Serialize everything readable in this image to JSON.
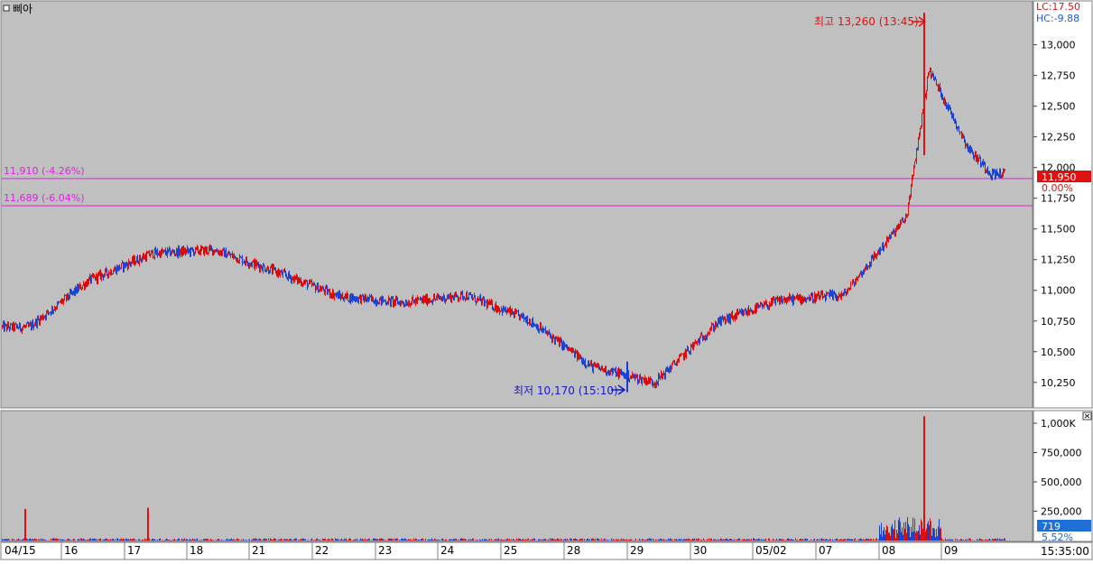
{
  "title": "삐아",
  "colors": {
    "plot_bg": "#c0c0c0",
    "up": "#e01010",
    "down": "#1840d0",
    "ref_line": "#e020e0",
    "max_label": "#e01010",
    "min_label": "#1818c8",
    "current_badge_bg": "#e01010",
    "volume_badge_bg": "#1f6fd6"
  },
  "header": {
    "lc": "LC:17.50",
    "hc": "HC:-9.88"
  },
  "price_panel": {
    "yticks": [
      "13,000",
      "12,750",
      "12,500",
      "12,250",
      "12,000",
      "11,750",
      "11,500",
      "11,250",
      "11,000",
      "10,750",
      "10,500",
      "10,250"
    ],
    "current_price": "11,950",
    "current_change": "0.00%",
    "ref_lines": [
      {
        "label": "11,910 (-4.26%)",
        "value": 11910
      },
      {
        "label": "11,689 (-6.04%)",
        "value": 11689
      }
    ],
    "max_label": "최고 13,260 (13:45)",
    "min_label": "최저 10,170 (15:10)"
  },
  "volume_panel": {
    "yticks": [
      "1,000K",
      "750,000",
      "500,000",
      "250,000"
    ],
    "current_volume": "719",
    "volume_pct": "5.52%"
  },
  "x_axis": {
    "labels": [
      "04/15",
      "16",
      "17",
      "18",
      "21",
      "22",
      "23",
      "24",
      "25",
      "28",
      "29",
      "30",
      "05/02",
      "07",
      "08",
      "09"
    ],
    "time": "15:35:00"
  },
  "chart_data": {
    "type": "line",
    "title": "삐아",
    "x_labels": [
      "04/15",
      "16",
      "17",
      "18",
      "21",
      "22",
      "23",
      "24",
      "25",
      "28",
      "29",
      "30",
      "05/02",
      "07",
      "08",
      "09"
    ],
    "ylim_price": [
      10050,
      13350
    ],
    "ylim_volume": [
      0,
      1100000
    ],
    "series": [
      {
        "x": [
          "04/15",
          "16",
          "17",
          "18",
          "21",
          "22",
          "23",
          "24",
          "25",
          "28",
          "29",
          "30",
          "05/02",
          "07",
          "08",
          "08",
          "09",
          "09"
        ],
        "values": [
          10700,
          11080,
          11300,
          11330,
          11150,
          10950,
          10900,
          10960,
          10760,
          10380,
          10250,
          10740,
          10920,
          10960,
          11600,
          12800,
          12150,
          11950
        ]
      }
    ],
    "annotations": [
      {
        "text": "최고 13,260 (13:45)",
        "x": "08",
        "y": 13260
      },
      {
        "text": "최저 10,170 (15:10)",
        "x": "29",
        "y": 10170
      }
    ],
    "volume_spikes": [
      {
        "x": "04/15",
        "value": 270000
      },
      {
        "x": "17",
        "value": 280000
      },
      {
        "x": "08",
        "value": 1060000
      }
    ]
  }
}
